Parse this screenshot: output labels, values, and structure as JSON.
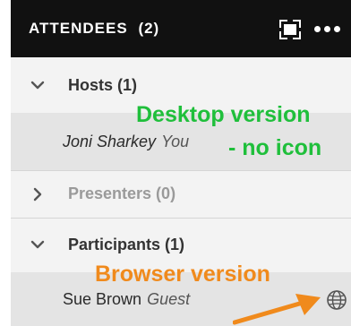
{
  "header": {
    "title": "ATTENDEES",
    "count": "(2)"
  },
  "groups": [
    {
      "label": "Hosts (1)",
      "expanded": true
    },
    {
      "label": "Presenters (0)",
      "expanded": false
    },
    {
      "label": "Participants (1)",
      "expanded": true
    }
  ],
  "attendees": [
    {
      "name": "Joni Sharkey",
      "role": "You",
      "client_icon": "none"
    },
    {
      "name": "Sue Brown",
      "role": "Guest",
      "client_icon": "globe-icon"
    }
  ],
  "annotations": {
    "desktop_line1": "Desktop version",
    "desktop_line2": "- no icon",
    "browser": "Browser version"
  },
  "colors": {
    "header_bg": "#111111",
    "panel_bg": "#f3f3f3",
    "attendee_row_bg": "#e4e4e4",
    "annotation_green": "#1fbf3b",
    "annotation_orange": "#f08a1c"
  },
  "icons": {
    "fullscreen": "fullscreen-icon",
    "more": "more-options-icon",
    "expanded": "chevron-down-icon",
    "collapsed": "chevron-right-icon",
    "browser_client": "globe-icon"
  }
}
